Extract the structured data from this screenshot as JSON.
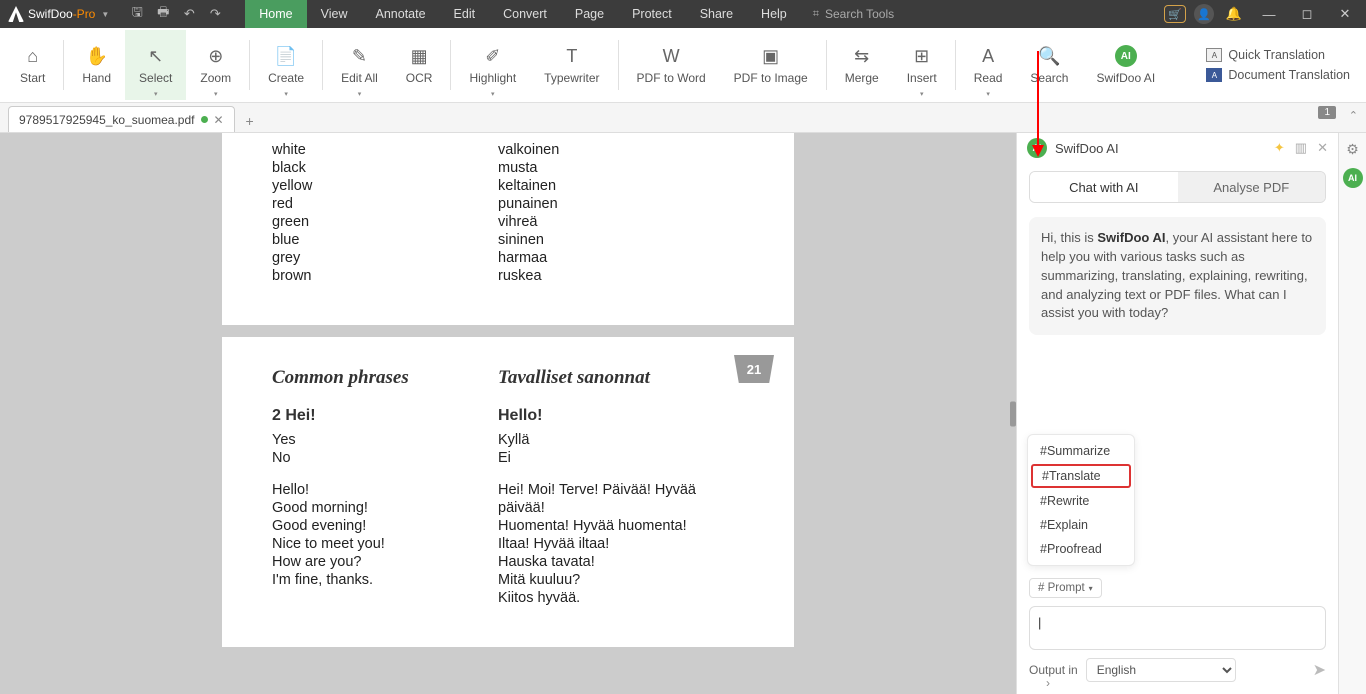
{
  "app": {
    "brand_a": "SwifDoo",
    "brand_b": "-Pro"
  },
  "menu": {
    "items": [
      "Home",
      "View",
      "Annotate",
      "Edit",
      "Convert",
      "Page",
      "Protect",
      "Share",
      "Help"
    ],
    "active": 0
  },
  "search": {
    "placeholder": "Search Tools"
  },
  "ribbon": {
    "buttons": [
      {
        "label": "Start",
        "icon": "⌂"
      },
      {
        "label": "Hand",
        "icon": "✋"
      },
      {
        "label": "Select",
        "icon": "↖"
      },
      {
        "label": "Zoom",
        "icon": "⊕"
      },
      {
        "label": "Create",
        "icon": "📄"
      },
      {
        "label": "Edit All",
        "icon": "✎"
      },
      {
        "label": "OCR",
        "icon": "▦"
      },
      {
        "label": "Highlight",
        "icon": "✐"
      },
      {
        "label": "Typewriter",
        "icon": "T"
      },
      {
        "label": "PDF to Word",
        "icon": "W"
      },
      {
        "label": "PDF to Image",
        "icon": "▣"
      },
      {
        "label": "Merge",
        "icon": "⇆"
      },
      {
        "label": "Insert",
        "icon": "⊞"
      },
      {
        "label": "Read",
        "icon": "A"
      },
      {
        "label": "Search",
        "icon": "🔍"
      },
      {
        "label": "SwifDoo AI",
        "icon": "AI"
      }
    ],
    "side": {
      "qt": "Quick Translation",
      "dt": "Document Translation"
    }
  },
  "tab": {
    "name": "9789517925945_ko_suomea.pdf",
    "badge": "1"
  },
  "doc": {
    "p1": {
      "left": [
        "white",
        "black",
        "yellow",
        "red",
        "green",
        "blue",
        "grey",
        "brown"
      ],
      "right": [
        "valkoinen",
        "musta",
        "keltainen",
        "punainen",
        "vihreä",
        "sininen",
        "harmaa",
        "ruskea"
      ]
    },
    "p2": {
      "pg": "21",
      "h1": "Common phrases",
      "h2": "Tavalliset sanonnat",
      "s1": "2 Hei!",
      "s2": "Hello!",
      "l1": [
        "Yes",
        "No"
      ],
      "r1": [
        "Kyllä",
        "Ei"
      ],
      "l2": [
        "Hello!",
        "Good morning!",
        "Good evening!",
        "Nice to meet you!",
        "How are you?",
        "I'm fine, thanks."
      ],
      "r2": [
        "Hei! Moi! Terve! Päivää! Hyvää päivää!",
        "Huomenta! Hyvää huomenta!",
        "Iltaa! Hyvää iltaa!",
        "Hauska tavata!",
        "Mitä kuuluu?",
        "Kiitos hyvää."
      ]
    }
  },
  "ai": {
    "title": "SwifDoo AI",
    "tab1": "Chat with AI",
    "tab2": "Analyse PDF",
    "greet_a": "Hi, this is ",
    "greet_b": "SwifDoo AI",
    "greet_c": ", your AI assistant here to help you with various tasks such as summarizing, translating, explaining, rewriting, and analyzing text or PDF files. What can I assist you with today?",
    "opts": [
      "#Summarize",
      "#Translate",
      "#Rewrite",
      "#Explain",
      "#Proofread"
    ],
    "prompt": "# Prompt",
    "out": "Output in",
    "lang": "English"
  }
}
